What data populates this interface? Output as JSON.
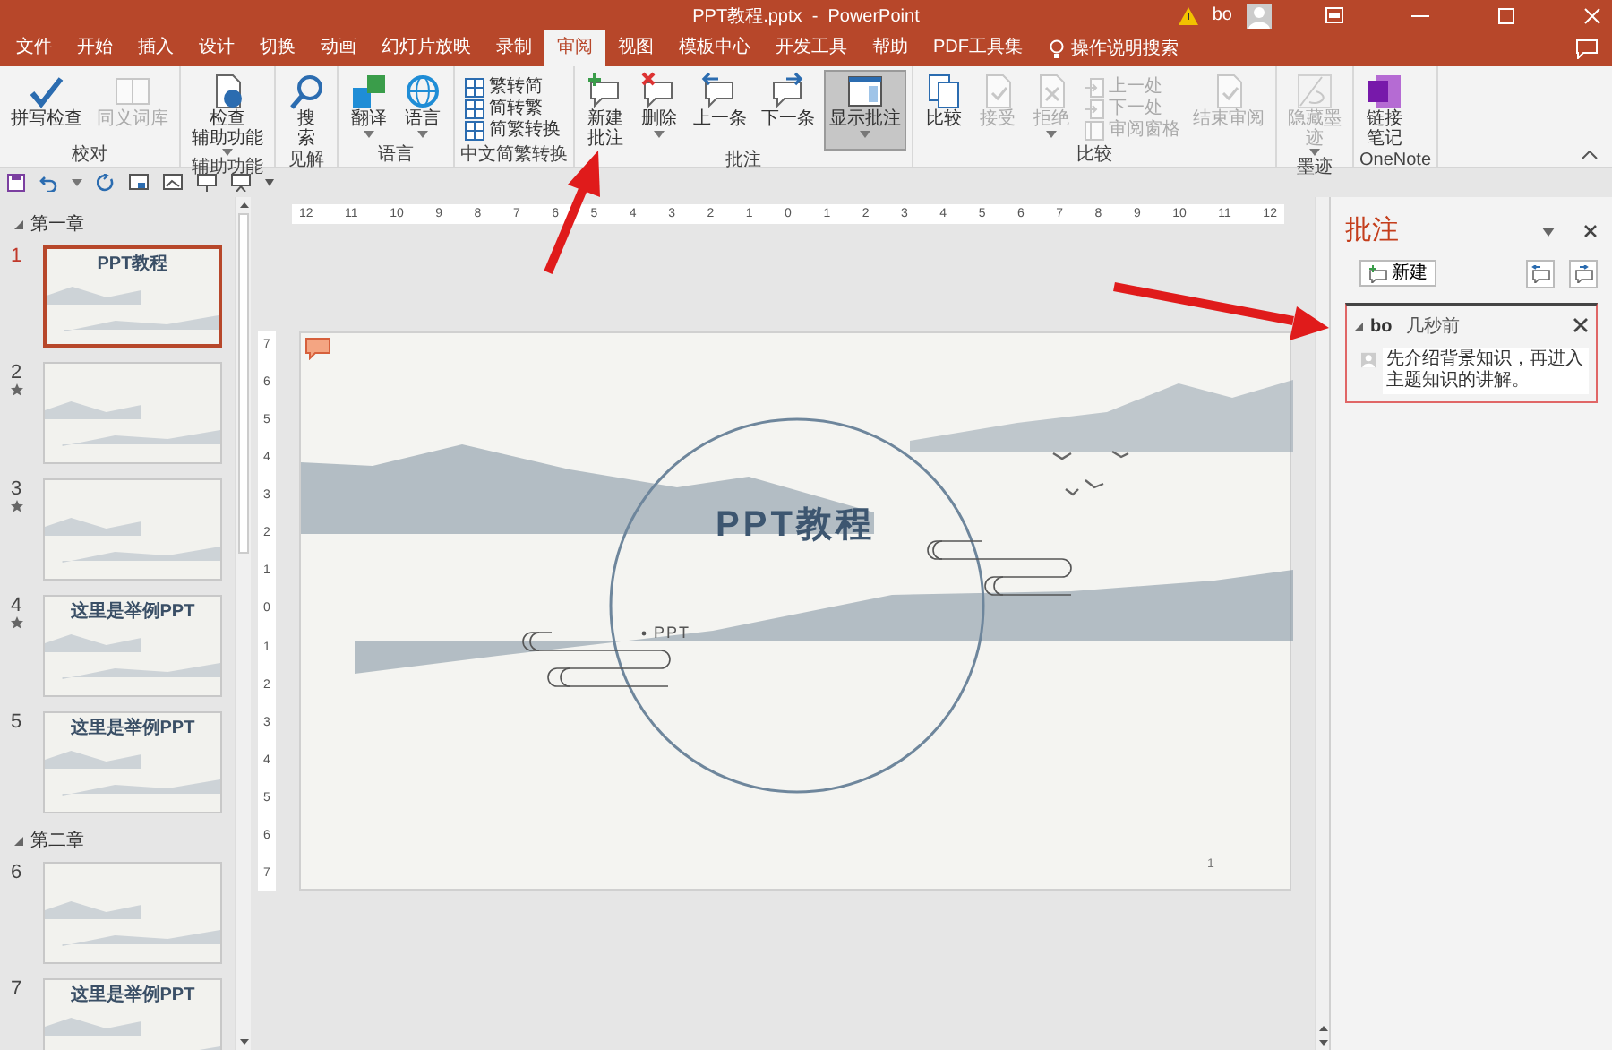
{
  "window": {
    "title": "PPT教程.pptx  -  PowerPoint",
    "user": "bo"
  },
  "menu_tabs": [
    {
      "label": "文件",
      "selected": false
    },
    {
      "label": "开始",
      "selected": false
    },
    {
      "label": "插入",
      "selected": false
    },
    {
      "label": "设计",
      "selected": false
    },
    {
      "label": "切换",
      "selected": false
    },
    {
      "label": "动画",
      "selected": false
    },
    {
      "label": "幻灯片放映",
      "selected": false
    },
    {
      "label": "录制",
      "selected": false
    },
    {
      "label": "审阅",
      "selected": true
    },
    {
      "label": "视图",
      "selected": false
    },
    {
      "label": "模板中心",
      "selected": false
    },
    {
      "label": "开发工具",
      "selected": false
    },
    {
      "label": "帮助",
      "selected": false
    },
    {
      "label": "PDF工具集",
      "selected": false
    }
  ],
  "tell_me": {
    "label": "操作说明搜索"
  },
  "ribbon_groups": [
    {
      "label": "校对",
      "buttons": [
        {
          "kind": "large",
          "label": "拼写检查",
          "disabled": false,
          "pressed": false
        },
        {
          "kind": "large",
          "label": "同义词库",
          "disabled": true,
          "pressed": false
        }
      ]
    },
    {
      "label": "辅助功能",
      "buttons": [
        {
          "kind": "large",
          "lines": [
            "检查",
            "辅助功能"
          ],
          "disabled": false,
          "pressed": false
        }
      ]
    },
    {
      "label": "见解",
      "buttons": [
        {
          "kind": "large",
          "lines": [
            "搜",
            "索"
          ],
          "disabled": false,
          "pressed": false
        }
      ]
    },
    {
      "label": "语言",
      "buttons": [
        {
          "kind": "large",
          "label": "翻译",
          "disabled": false,
          "pressed": false
        },
        {
          "kind": "large",
          "label": "语言",
          "disabled": false,
          "pressed": false
        }
      ]
    },
    {
      "label": "中文简繁转换",
      "buttons": [
        {
          "kind": "small",
          "label": "繁转简",
          "disabled": false,
          "pressed": false
        },
        {
          "kind": "small",
          "label": "简转繁",
          "disabled": false,
          "pressed": false
        },
        {
          "kind": "small",
          "label": "简繁转换",
          "disabled": false,
          "pressed": false
        }
      ]
    },
    {
      "label": "批注",
      "buttons": [
        {
          "kind": "large",
          "lines": [
            "新建",
            "批注"
          ],
          "disabled": false,
          "pressed": false
        },
        {
          "kind": "large",
          "label": "删除",
          "disabled": false,
          "pressed": false
        },
        {
          "kind": "large",
          "label": "上一条",
          "disabled": false,
          "pressed": false
        },
        {
          "kind": "large",
          "label": "下一条",
          "disabled": false,
          "pressed": false
        },
        {
          "kind": "large",
          "label": "显示批注",
          "disabled": false,
          "pressed": true
        }
      ]
    },
    {
      "label": "比较",
      "buttons": [
        {
          "kind": "large",
          "label": "比较",
          "disabled": false,
          "pressed": false
        },
        {
          "kind": "large",
          "label": "接受",
          "disabled": true,
          "pressed": false
        },
        {
          "kind": "large",
          "label": "拒绝",
          "disabled": true,
          "pressed": false
        },
        {
          "kind": "small",
          "label": "上一处",
          "disabled": true,
          "pressed": false
        },
        {
          "kind": "small",
          "label": "下一处",
          "disabled": true,
          "pressed": false
        },
        {
          "kind": "small",
          "label": "审阅窗格",
          "disabled": true,
          "pressed": false
        },
        {
          "kind": "large",
          "label": "结束审阅",
          "disabled": true,
          "pressed": false
        }
      ]
    },
    {
      "label": "墨迹",
      "buttons": [
        {
          "kind": "large",
          "lines": [
            "隐藏墨",
            "迹"
          ],
          "disabled": true,
          "pressed": false
        }
      ]
    },
    {
      "label": "OneNote",
      "buttons": [
        {
          "kind": "large",
          "lines": [
            "链接",
            "笔记"
          ],
          "disabled": false,
          "pressed": false
        }
      ]
    }
  ],
  "slide_panel": {
    "sections": [
      {
        "title": "第一章",
        "expanded": true,
        "slides": [
          {
            "number": "1",
            "selected": true,
            "animated": false,
            "title": "PPT教程"
          },
          {
            "number": "2",
            "selected": false,
            "animated": true
          },
          {
            "number": "3",
            "selected": false,
            "animated": true
          },
          {
            "number": "4",
            "selected": false,
            "animated": true,
            "title": "这里是举例PPT"
          },
          {
            "number": "5",
            "selected": false,
            "animated": false,
            "title": "这里是举例PPT"
          }
        ]
      },
      {
        "title": "第二章",
        "expanded": true,
        "slides": [
          {
            "number": "6",
            "selected": false,
            "animated": false
          },
          {
            "number": "7",
            "selected": false,
            "animated": false,
            "title": "这里是举例PPT"
          }
        ]
      }
    ]
  },
  "rulers": {
    "horizontal": [
      "12",
      "11",
      "10",
      "9",
      "8",
      "7",
      "6",
      "5",
      "4",
      "3",
      "2",
      "1",
      "0",
      "1",
      "2",
      "3",
      "4",
      "5",
      "6",
      "7",
      "8",
      "9",
      "10",
      "11",
      "12"
    ],
    "vertical": [
      "7",
      "6",
      "5",
      "4",
      "3",
      "2",
      "1",
      "0",
      "1",
      "2",
      "3",
      "4",
      "5",
      "6",
      "7"
    ]
  },
  "slide": {
    "title": "PPT教程",
    "subtitle": "PPT",
    "page_number": "1",
    "comment_marker": true
  },
  "comments_pane": {
    "title": "批注",
    "new_button": "新建",
    "comments": [
      {
        "author": "bo",
        "time": "几秒前",
        "text": "先介绍背景知识，再进入主题知识的讲解。",
        "selected": true
      }
    ]
  }
}
